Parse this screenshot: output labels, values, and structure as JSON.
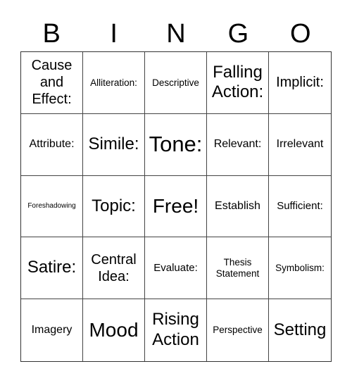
{
  "header": [
    "B",
    "I",
    "N",
    "G",
    "O"
  ],
  "cells": [
    "Cause and Effect:",
    "Alliteration:",
    "Descriptive",
    "Falling Action:",
    "Implicit:",
    "Attribute:",
    "Simile:",
    "Tone:",
    "Relevant:",
    "Irrelevant",
    "Foreshadowing",
    "Topic:",
    "Free!",
    "Establish",
    "Sufficient:",
    "Satire:",
    "Central Idea:",
    "Evaluate:",
    "Thesis Statement",
    "Symbolism:",
    "Imagery",
    "Mood",
    "Rising Action",
    "Perspective",
    "Setting"
  ]
}
